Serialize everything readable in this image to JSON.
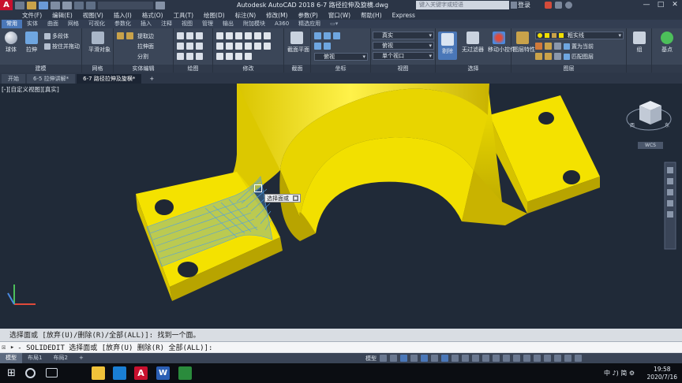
{
  "titlebar": {
    "app_letter": "A",
    "title": "Autodesk AutoCAD 2018    6-7 路径拉伸及旋横.dwg",
    "search_placeholder": "键入关键字或短语",
    "login": "登录",
    "minimize": "—",
    "restore": "□",
    "close": "✕"
  },
  "menu": [
    "文件(F)",
    "编辑(E)",
    "视图(V)",
    "插入(I)",
    "格式(O)",
    "工具(T)",
    "绘图(D)",
    "标注(N)",
    "修改(M)",
    "参数(P)",
    "窗口(W)",
    "帮助(H)",
    "Express"
  ],
  "ribbon_tabs": [
    "常用",
    "实体",
    "曲面",
    "网格",
    "可视化",
    "参数化",
    "插入",
    "注释",
    "视图",
    "管理",
    "输出",
    "附加模块",
    "A360",
    "精选应用"
  ],
  "ribbon": {
    "panels": [
      {
        "title": "建模"
      },
      {
        "title": "网格"
      },
      {
        "title": "实体编辑"
      },
      {
        "title": "绘图"
      },
      {
        "title": "修改"
      },
      {
        "title": "截面"
      },
      {
        "title": "坐标"
      },
      {
        "title": "视图"
      },
      {
        "title": "选择"
      },
      {
        "title": "图层"
      },
      {
        "title": ""
      },
      {
        "title": ""
      }
    ],
    "model": {
      "box": "球体",
      "extrude": "拉伸",
      "multi": "多段体",
      "presspull": "按住并拖动"
    },
    "mesh": {
      "smooth": "平滑对象"
    },
    "solid_edit": {
      "extract_edges": "提取边",
      "extrude_faces": "拉伸面",
      "separate": "分割"
    },
    "section": {
      "plane": "截面平面"
    },
    "view": {
      "visual_style": "真实",
      "view_name": "俯视",
      "plan": "俯视",
      "viewports": "单个视口"
    },
    "selection": {
      "culling": "剔除",
      "no_filter": "无过滤器",
      "gizmo": "移动小控件"
    },
    "layers": {
      "layer_props": "图层特性",
      "layer_name": "粗实线",
      "set_current": "置为当前",
      "match": "匹配图层"
    },
    "groups": {
      "group": "组"
    },
    "base": {
      "label": "基点"
    }
  },
  "file_tabs": [
    "开始",
    "6-5 拉伸讲解*",
    "6-7 路径拉伸及旋横*"
  ],
  "viewport": {
    "label": "[-][自定义视图][真实]",
    "tooltip": "选择面或",
    "tooltip_close": "□",
    "viewcube_label": "东南",
    "wcs_label": "WCS"
  },
  "command": {
    "history": "选择面或 [放弃(U)/删除(R)/全部(ALL)]: 找到一个面。",
    "prefix": "☒ ▸",
    "current": "- SOLIDEDIT 选择面或 [放弃(U) 删除(R) 全部(ALL)]:"
  },
  "layout_tabs": [
    "模型",
    "布局1",
    "布局2",
    "+"
  ],
  "statusbar": {
    "model": "模型"
  },
  "taskbar": {
    "tray": "中 ♪) 简 ⚙",
    "time": "19:58",
    "date": "2020/7/16"
  },
  "colors": {
    "part": "#f2e000",
    "part_shadow": "#b8a400",
    "selection": "#4f9fe8",
    "viewport_bg": "#202a38",
    "ribbon_accent": "#4a77b8"
  }
}
